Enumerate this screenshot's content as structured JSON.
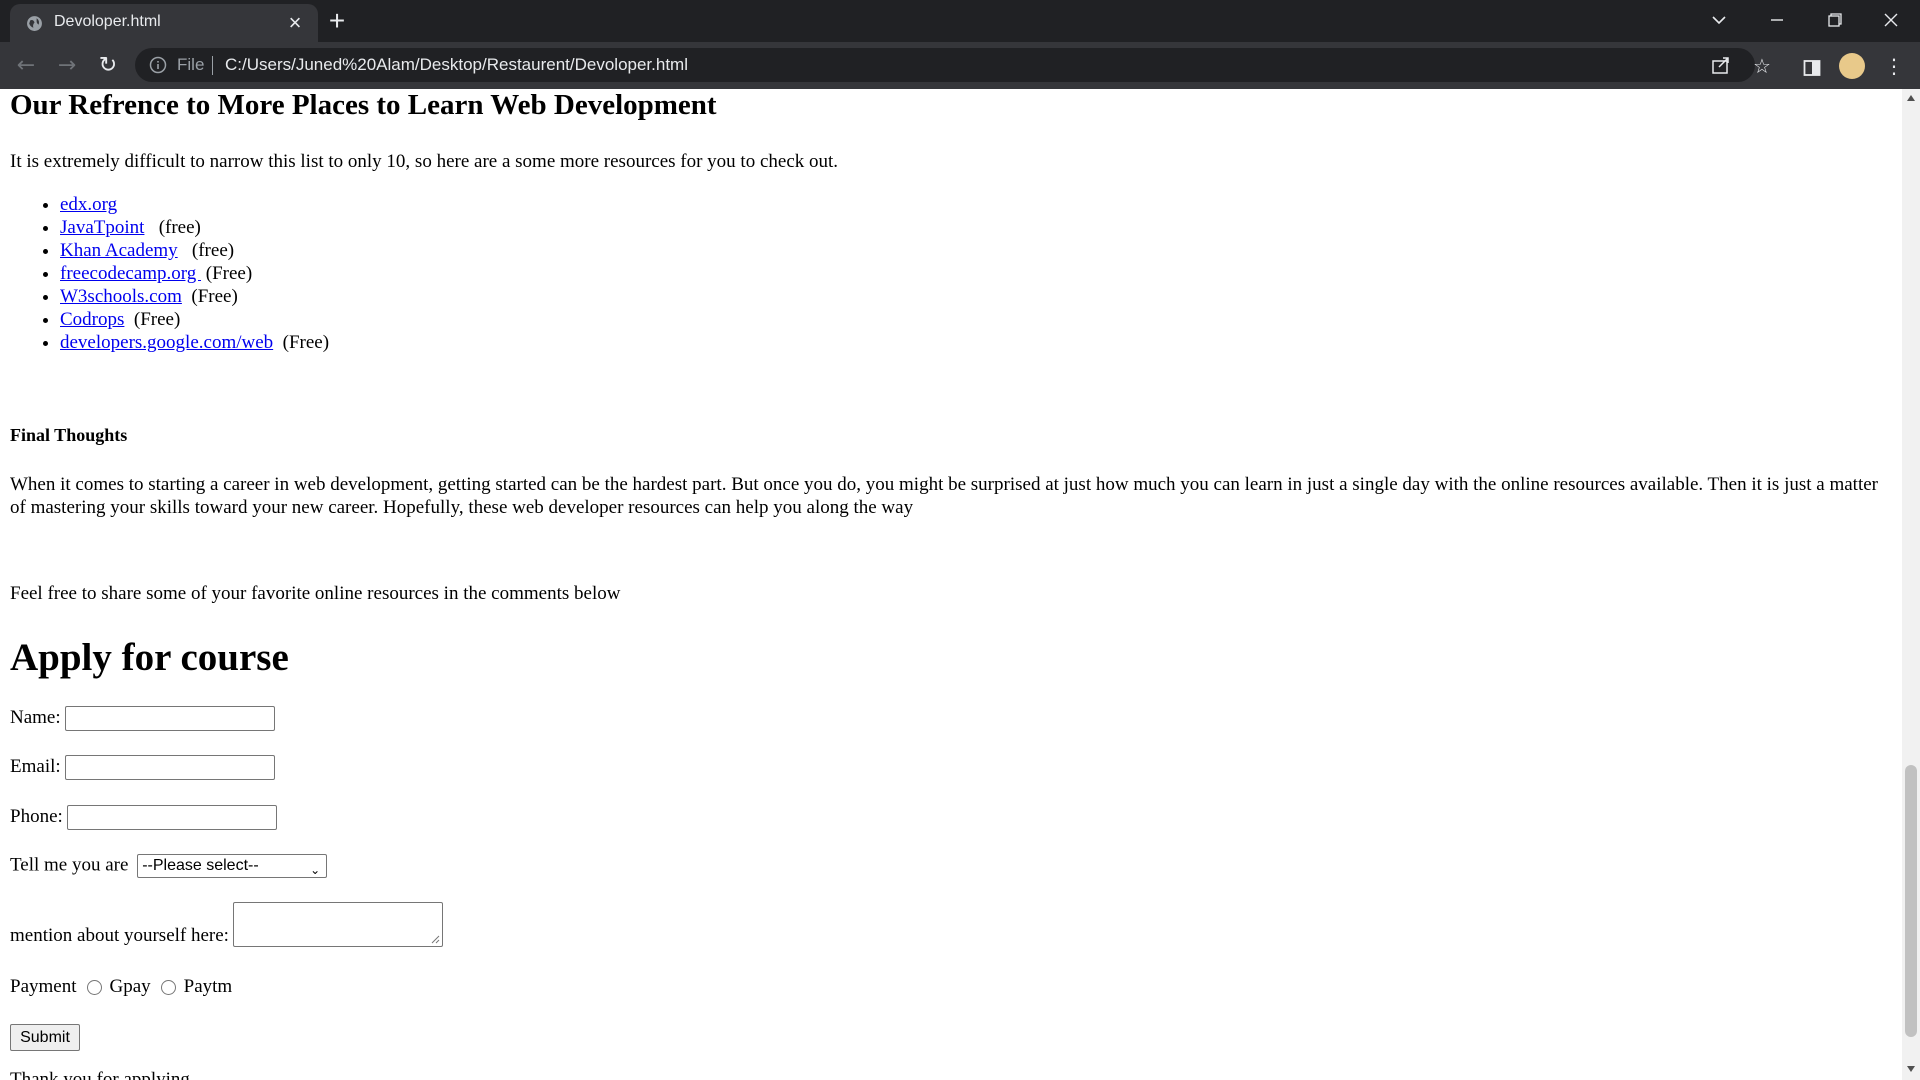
{
  "browser": {
    "tab_title": "Devoloper.html",
    "scheme_label": "File",
    "url": "C:/Users/Juned%20Alam/Desktop/Restaurent/Devoloper.html"
  },
  "page": {
    "ref_heading": "Our Refrence to More Places to Learn Web Development",
    "intro": "It is extremely difficult to narrow this list to only 10, so here are a some more resources for you to check out.",
    "resources": [
      {
        "link": "edx.org",
        "note": ""
      },
      {
        "link": "JavaTpoint",
        "note": "(free)"
      },
      {
        "link": "Khan Academy",
        "note": "(free)"
      },
      {
        "link": "freecodecamp.org ",
        "note": "(Free)"
      },
      {
        "link": "W3schools.com",
        "note": "(Free)"
      },
      {
        "link": "Codrops",
        "note": "(Free)"
      },
      {
        "link": "developers.google.com/web",
        "note": "(Free)"
      }
    ],
    "final_title": "Final Thoughts",
    "final_text": "When it comes to starting a career in web development, getting started can be the hardest part. But once you do, you might be surprised at just how much you can learn in just a single day with the online resources available. Then it is just a matter of mastering your skills toward your new career. Hopefully, these web developer resources can help you along the way",
    "share_text": "Feel free to share some of your favorite online resources in the comments below",
    "form": {
      "heading": "Apply for course",
      "name_label": "Name:",
      "email_label": "Email:",
      "phone_label": "Phone:",
      "select_label": "Tell me you are",
      "select_value": "--Please select--",
      "about_label": "mention about yourself here:",
      "payment_label": "Payment",
      "option_gpay": "Gpay",
      "option_paytm": "Paytm",
      "submit_label": "Submit"
    },
    "cutoff_text": "Thank you for applying"
  }
}
